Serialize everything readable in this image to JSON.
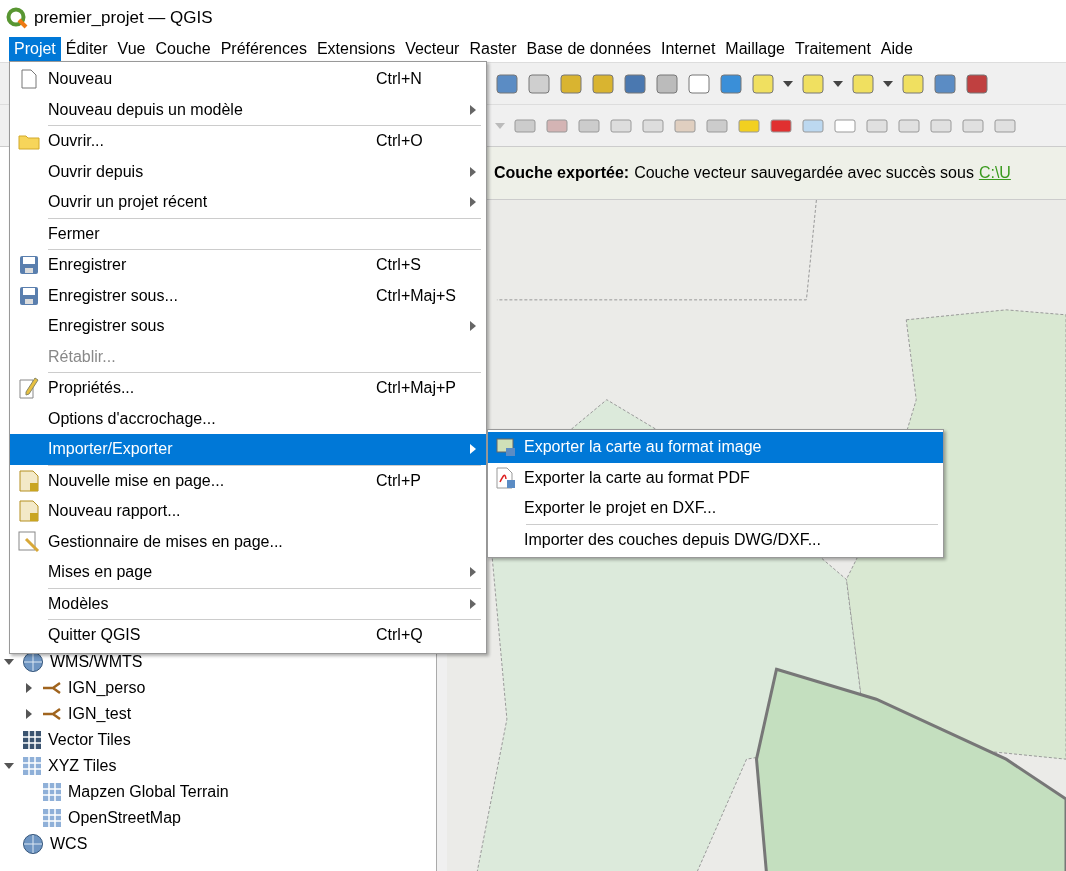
{
  "window": {
    "title": "premier_projet — QGIS"
  },
  "menubar": [
    {
      "label": "Projet",
      "selected": true
    },
    {
      "label": "Éditer",
      "selected": false
    },
    {
      "label": "Vue",
      "selected": false
    },
    {
      "label": "Couche",
      "selected": false
    },
    {
      "label": "Préférences",
      "selected": false
    },
    {
      "label": "Extensions",
      "selected": false
    },
    {
      "label": "Vecteur",
      "selected": false
    },
    {
      "label": "Raster",
      "selected": false
    },
    {
      "label": "Base de données",
      "selected": false
    },
    {
      "label": "Internet",
      "selected": false
    },
    {
      "label": "Maillage",
      "selected": false
    },
    {
      "label": "Traitement",
      "selected": false
    },
    {
      "label": "Aide",
      "selected": false
    }
  ],
  "message_bar": {
    "title": "Couche exportée:",
    "text": "Couche vecteur sauvegardée avec succès sous",
    "link": "C:\\U"
  },
  "browser_panel": {
    "tree": [
      {
        "label": "WMS/WMTS",
        "expanded": true,
        "children": [
          {
            "label": "IGN_perso",
            "expanded": false
          },
          {
            "label": "IGN_test",
            "expanded": false
          }
        ]
      },
      {
        "label": "Vector Tiles"
      },
      {
        "label": "XYZ Tiles",
        "expanded": true,
        "children": [
          {
            "label": "Mapzen Global Terrain"
          },
          {
            "label": "OpenStreetMap"
          }
        ]
      },
      {
        "label": "WCS"
      }
    ]
  },
  "project_menu": [
    {
      "kind": "item",
      "label": "Nouveau",
      "shortcut": "Ctrl+N",
      "disabled": false,
      "selected": false,
      "submenu": false
    },
    {
      "kind": "item",
      "label": "Nouveau depuis un modèle",
      "disabled": false,
      "selected": false,
      "submenu": true
    },
    {
      "kind": "separator"
    },
    {
      "kind": "item",
      "label": "Ouvrir...",
      "shortcut": "Ctrl+O",
      "disabled": false,
      "selected": false,
      "submenu": false
    },
    {
      "kind": "item",
      "label": "Ouvrir depuis",
      "disabled": false,
      "selected": false,
      "submenu": true
    },
    {
      "kind": "item",
      "label": "Ouvrir un projet récent",
      "disabled": false,
      "selected": false,
      "submenu": true
    },
    {
      "kind": "separator"
    },
    {
      "kind": "item",
      "label": "Fermer",
      "disabled": false,
      "selected": false,
      "submenu": false
    },
    {
      "kind": "separator"
    },
    {
      "kind": "item",
      "label": "Enregistrer",
      "shortcut": "Ctrl+S",
      "disabled": false,
      "selected": false,
      "submenu": false
    },
    {
      "kind": "item",
      "label": "Enregistrer sous...",
      "shortcut": "Ctrl+Maj+S",
      "disabled": false,
      "selected": false,
      "submenu": false
    },
    {
      "kind": "item",
      "label": "Enregistrer sous",
      "disabled": false,
      "selected": false,
      "submenu": true
    },
    {
      "kind": "item",
      "label": "Rétablir...",
      "disabled": true,
      "selected": false,
      "submenu": false
    },
    {
      "kind": "separator"
    },
    {
      "kind": "item",
      "label": "Propriétés...",
      "shortcut": "Ctrl+Maj+P",
      "disabled": false,
      "selected": false,
      "submenu": false
    },
    {
      "kind": "item",
      "label": "Options d'accrochage...",
      "disabled": false,
      "selected": false,
      "submenu": false
    },
    {
      "kind": "item",
      "label": "Importer/Exporter",
      "disabled": false,
      "selected": true,
      "submenu": true
    },
    {
      "kind": "separator"
    },
    {
      "kind": "item",
      "label": "Nouvelle mise en page...",
      "shortcut": "Ctrl+P",
      "disabled": false,
      "selected": false,
      "submenu": false
    },
    {
      "kind": "item",
      "label": "Nouveau rapport...",
      "disabled": false,
      "selected": false,
      "submenu": false
    },
    {
      "kind": "item",
      "label": "Gestionnaire de mises en page...",
      "disabled": false,
      "selected": false,
      "submenu": false
    },
    {
      "kind": "item",
      "label": "Mises en page",
      "disabled": false,
      "selected": false,
      "submenu": true
    },
    {
      "kind": "separator"
    },
    {
      "kind": "item",
      "label": "Modèles",
      "disabled": false,
      "selected": false,
      "submenu": true
    },
    {
      "kind": "separator"
    },
    {
      "kind": "item",
      "label": "Quitter QGIS",
      "shortcut": "Ctrl+Q",
      "disabled": false,
      "selected": false,
      "submenu": false
    }
  ],
  "import_export_menu": [
    {
      "kind": "item",
      "label": "Exporter la carte au format image",
      "selected": true
    },
    {
      "kind": "item",
      "label": "Exporter la carte au format PDF",
      "selected": false
    },
    {
      "kind": "item",
      "label": "Exporter le projet en DXF...",
      "selected": false
    },
    {
      "kind": "separator"
    },
    {
      "kind": "item",
      "label": "Importer des couches depuis DWG/DXF...",
      "selected": false
    }
  ]
}
